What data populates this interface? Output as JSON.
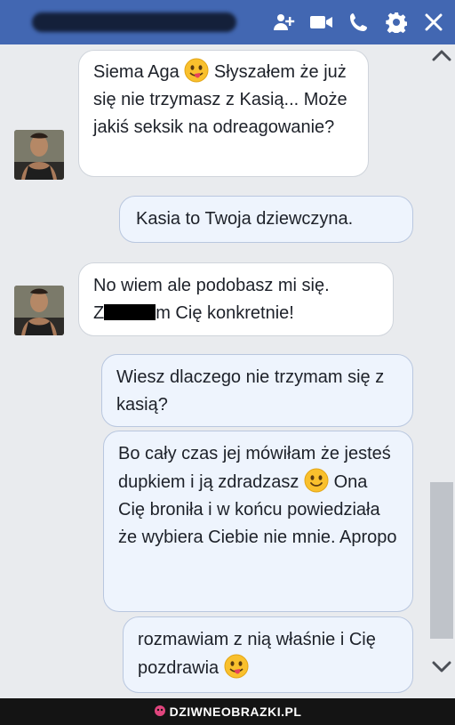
{
  "header": {
    "contact_name": "",
    "icons": [
      "add-person-icon",
      "video-call-icon",
      "phone-icon",
      "settings-gear-icon",
      "close-icon"
    ]
  },
  "messages": [
    {
      "direction": "incoming",
      "parts": [
        "Siema Aga",
        "Słyszałem że już się nie trzymasz z Kasią... Może jakiś seksik na odreagowanie?"
      ],
      "emoji": "tongue-out-emoji"
    },
    {
      "direction": "outgoing",
      "text": "Kasia to Twoja dziewczyna."
    },
    {
      "direction": "incoming",
      "line1": "No wiem ale podobasz mi się.",
      "line2_start": "Z",
      "line2_end": "m Cię konkretnie!"
    },
    {
      "direction": "outgoing",
      "text": "Wiesz dlaczego nie trzymam się z kasią?"
    },
    {
      "direction": "outgoing",
      "part1": "Bo cały czas jej mówiłam że jesteś dupkiem i ją zdradzasz",
      "part2": "Ona Cię broniła i w końcu powiedziała że wybiera Ciebie nie mnie. Apropo",
      "emoji": "smile-emoji"
    },
    {
      "direction": "outgoing",
      "text": "rozmawiam z nią właśnie i Cię pozdrawia",
      "emoji": "tongue-out-emoji"
    }
  ],
  "footer": {
    "brand": "DZIWNEOBRAZKI.PL",
    "brand_color": "#e0457d"
  },
  "colors": {
    "header_bg": "#4267b2",
    "chat_bg": "#e9ebee",
    "outgoing_bubble": "#eef4fd"
  }
}
